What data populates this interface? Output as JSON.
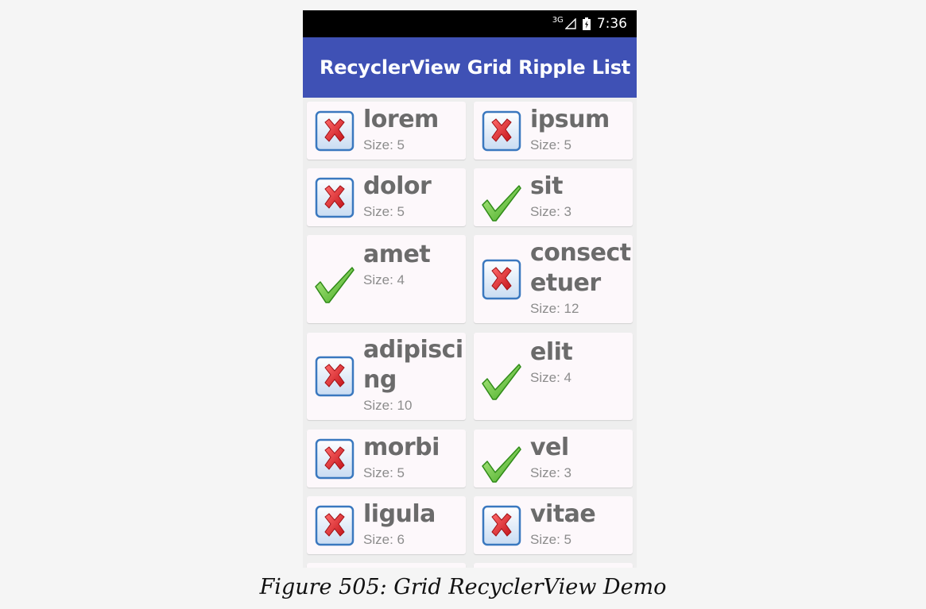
{
  "status_bar": {
    "network": "3G",
    "time": "7:36"
  },
  "app_bar": {
    "title": "RecyclerView Grid Ripple List"
  },
  "items": [
    {
      "word": "lorem",
      "size": "Size: 5",
      "icon": "x-mark-icon"
    },
    {
      "word": "ipsum",
      "size": "Size: 5",
      "icon": "x-mark-icon"
    },
    {
      "word": "dolor",
      "size": "Size: 5",
      "icon": "x-mark-icon"
    },
    {
      "word": "sit",
      "size": "Size: 3",
      "icon": "check-mark-icon"
    },
    {
      "word": "amet",
      "size": "Size: 4",
      "icon": "check-mark-icon"
    },
    {
      "word": "consectetuer",
      "size": "Size: 12",
      "icon": "x-mark-icon"
    },
    {
      "word": "adipiscing",
      "size": "Size: 10",
      "icon": "x-mark-icon"
    },
    {
      "word": "elit",
      "size": "Size: 4",
      "icon": "check-mark-icon"
    },
    {
      "word": "morbi",
      "size": "Size: 5",
      "icon": "x-mark-icon"
    },
    {
      "word": "vel",
      "size": "Size: 3",
      "icon": "check-mark-icon"
    },
    {
      "word": "ligula",
      "size": "Size: 6",
      "icon": "x-mark-icon"
    },
    {
      "word": "vitae",
      "size": "Size: 5",
      "icon": "x-mark-icon"
    }
  ],
  "caption": "Figure 505: Grid RecyclerView Demo",
  "colors": {
    "app_bar": "#3f51b5",
    "status_bar": "#000000",
    "card": "#fdf8fb",
    "x_red": "#e0242a",
    "check_green": "#5fc83c"
  }
}
